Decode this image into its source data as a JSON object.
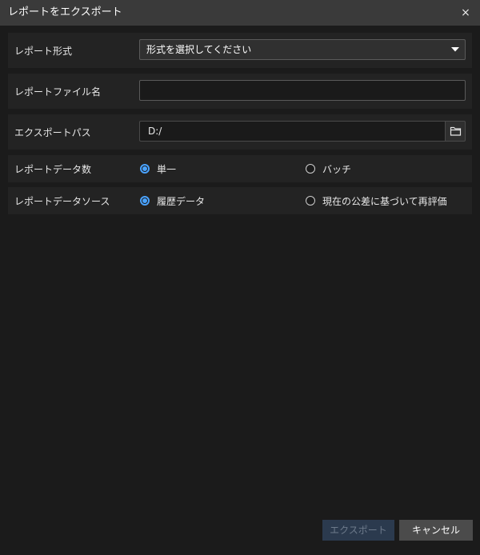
{
  "dialog": {
    "title": "レポートをエクスポート",
    "close_glyph": "×"
  },
  "form": {
    "format": {
      "label": "レポート形式",
      "value": "形式を選択してください"
    },
    "filename": {
      "label": "レポートファイル名",
      "value": ""
    },
    "path": {
      "label": "エクスポートパス",
      "value": "D:/"
    },
    "data_count": {
      "label": "レポートデータ数",
      "options": [
        "単一",
        "バッチ"
      ],
      "selected": "単一"
    },
    "data_source": {
      "label": "レポートデータソース",
      "options": [
        "履歴データ",
        "現在の公差に基づいて再評価"
      ],
      "selected": "履歴データ"
    }
  },
  "footer": {
    "export_label": "エクスポート",
    "cancel_label": "キャンセル"
  },
  "colors": {
    "accent": "#4aa3ff",
    "titlebar": "#3a3a3a",
    "background": "#1b1b1b",
    "row": "#232323",
    "export_disabled": "#2b3a4e"
  },
  "icons": [
    "close-icon",
    "chevron-down-icon",
    "folder-icon"
  ]
}
